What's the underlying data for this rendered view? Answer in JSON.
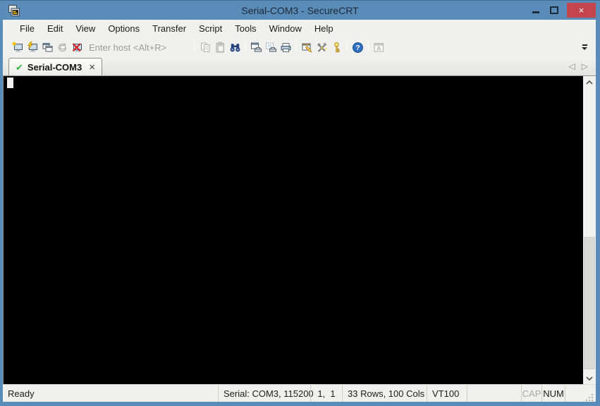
{
  "window": {
    "title": "Serial-COM3 - SecureCRT",
    "controls": {
      "close_glyph": "×"
    }
  },
  "menu": {
    "items": [
      "File",
      "Edit",
      "View",
      "Options",
      "Transfer",
      "Script",
      "Tools",
      "Window",
      "Help"
    ]
  },
  "toolbar": {
    "host_placeholder": "Enter host <Alt+R>",
    "help_glyph": "?",
    "securefx_glyph": "A",
    "buttons": [
      {
        "name": "connect",
        "enabled": true
      },
      {
        "name": "quick-connect",
        "enabled": true
      },
      {
        "name": "connect-in-tab",
        "enabled": true
      },
      {
        "name": "reconnect",
        "enabled": false
      },
      {
        "name": "disconnect",
        "enabled": true
      },
      {
        "name": "copy",
        "enabled": false
      },
      {
        "name": "paste",
        "enabled": false
      },
      {
        "name": "find",
        "enabled": true
      },
      {
        "name": "print-screen",
        "enabled": true
      },
      {
        "name": "print-selection",
        "enabled": true
      },
      {
        "name": "print",
        "enabled": true
      },
      {
        "name": "session-options",
        "enabled": true
      },
      {
        "name": "global-options",
        "enabled": true
      },
      {
        "name": "agent-key",
        "enabled": true
      },
      {
        "name": "help",
        "enabled": true
      },
      {
        "name": "securefx",
        "enabled": false
      }
    ]
  },
  "tabs": {
    "active": {
      "label": "Serial-COM3",
      "check_glyph": "✔",
      "close_glyph": "×",
      "connected": true
    },
    "nav": {
      "left_glyph": "◁",
      "right_glyph": "▷"
    }
  },
  "terminal": {
    "content": "",
    "cursor_visible": true,
    "cursor_row": 1,
    "cursor_col": 1
  },
  "status_bar": {
    "ready": "Ready",
    "connection": "Serial: COM3, 115200",
    "cursor_position": "1,  1",
    "terminal_size": "33 Rows, 100 Cols",
    "emulation": "VT100",
    "caps_lock": {
      "label": "CAP",
      "active": false
    },
    "num_lock": {
      "label": "NUM",
      "active": true
    }
  },
  "colors": {
    "titlebar_blue": "#5a8cba",
    "close_button_red": "#c4454e",
    "terminal_background": "#000000",
    "cursor_white": "#f2f2f2",
    "tab_check_green": "#3cb043",
    "chrome_gray": "#f0f0ee"
  }
}
